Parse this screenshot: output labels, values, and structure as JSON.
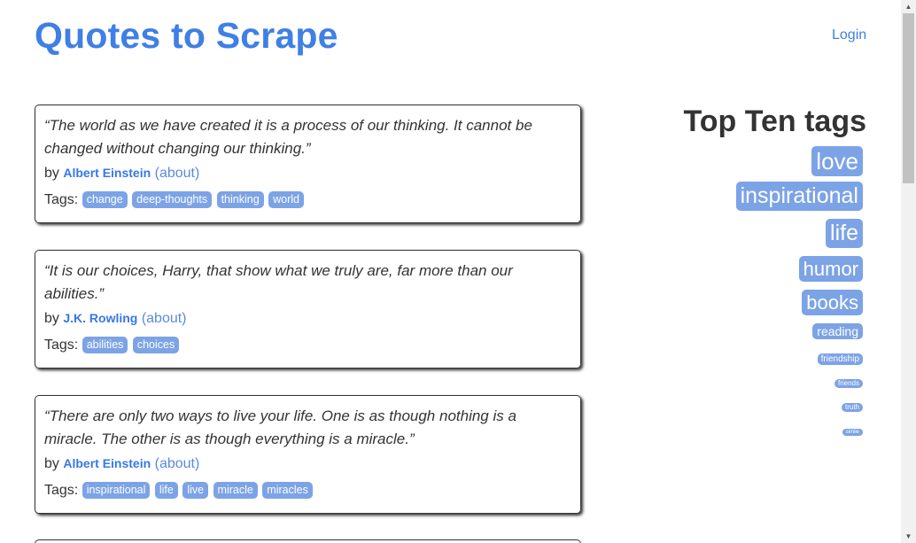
{
  "header": {
    "title": "Quotes to Scrape",
    "login": "Login"
  },
  "quotes": [
    {
      "text": "“The world as we have created it is a process of our thinking. It cannot be changed without changing our thinking.”",
      "by": "by",
      "author": "Albert Einstein",
      "about": "(about)",
      "tags_label": "Tags:",
      "tags": [
        "change",
        "deep-thoughts",
        "thinking",
        "world"
      ]
    },
    {
      "text": "“It is our choices, Harry, that show what we truly are, far more than our abilities.”",
      "by": "by",
      "author": "J.K. Rowling",
      "about": "(about)",
      "tags_label": "Tags:",
      "tags": [
        "abilities",
        "choices"
      ]
    },
    {
      "text": "“There are only two ways to live your life. One is as though nothing is a miracle. The other is as though everything is a miracle.”",
      "by": "by",
      "author": "Albert Einstein",
      "about": "(about)",
      "tags_label": "Tags:",
      "tags": [
        "inspirational",
        "life",
        "live",
        "miracle",
        "miracles"
      ]
    }
  ],
  "sidebar": {
    "heading": "Top Ten tags",
    "tags": [
      {
        "label": "love",
        "level": 10
      },
      {
        "label": "inspirational",
        "level": 9
      },
      {
        "label": "life",
        "level": 9
      },
      {
        "label": "humor",
        "level": 8
      },
      {
        "label": "books",
        "level": 8
      },
      {
        "label": "reading",
        "level": 5
      },
      {
        "label": "friendship",
        "level": 3
      },
      {
        "label": "friends",
        "level": 2
      },
      {
        "label": "truth",
        "level": 2
      },
      {
        "label": "simile",
        "level": 1
      }
    ]
  },
  "colors": {
    "accent": "#3f7fe6",
    "tag_bg": "#7ca3e6",
    "text": "#333333"
  }
}
